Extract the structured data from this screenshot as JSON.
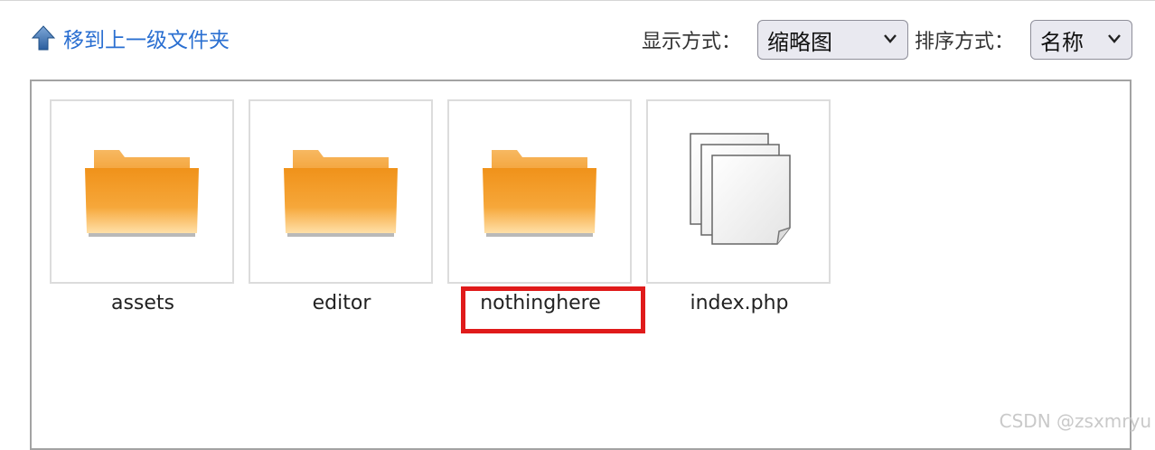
{
  "toolbar": {
    "up_link_label": "移到上一级文件夹",
    "display_mode_label": "显示方式：",
    "display_mode_value": "缩略图",
    "sort_label": "排序方式：",
    "sort_value": "名称"
  },
  "files": [
    {
      "name": "assets",
      "type": "folder",
      "icon": "folder-icon"
    },
    {
      "name": "editor",
      "type": "folder",
      "icon": "folder-icon"
    },
    {
      "name": "nothinghere",
      "type": "folder",
      "icon": "folder-icon"
    },
    {
      "name": "index.php",
      "type": "file",
      "icon": "file-stack-icon"
    }
  ],
  "colors": {
    "link": "#2a6fd1",
    "highlight": "#e01b1b",
    "folder": "#f19a1e"
  },
  "watermark": "CSDN @zsxmryu"
}
